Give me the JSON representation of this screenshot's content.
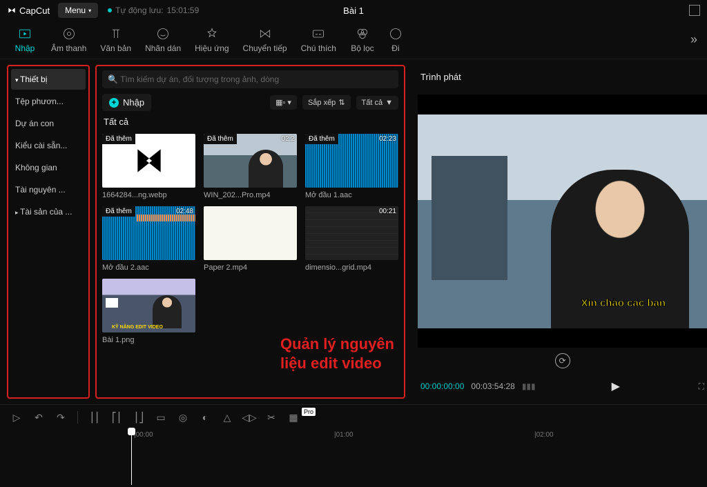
{
  "app": {
    "name": "CapCut",
    "menu_label": "Menu",
    "autosave_prefix": "Tự động lưu:",
    "autosave_time": "15:01:59",
    "project_title": "Bài 1"
  },
  "tabs": [
    {
      "label": "Nhập",
      "icon": "import-icon"
    },
    {
      "label": "Âm thanh",
      "icon": "audio-icon"
    },
    {
      "label": "Văn bản",
      "icon": "text-icon"
    },
    {
      "label": "Nhãn dán",
      "icon": "sticker-icon"
    },
    {
      "label": "Hiệu ứng",
      "icon": "effect-icon"
    },
    {
      "label": "Chuyển tiếp",
      "icon": "transition-icon"
    },
    {
      "label": "Chú thích",
      "icon": "caption-icon"
    },
    {
      "label": "Bộ lọc",
      "icon": "filter-icon"
    },
    {
      "label": "Đi",
      "icon": "adjust-icon"
    }
  ],
  "sidebar": [
    {
      "label": "Thiết bị",
      "kind": "active-expand"
    },
    {
      "label": "Tệp phươn...",
      "kind": ""
    },
    {
      "label": "Dự án con",
      "kind": ""
    },
    {
      "label": "Kiểu cài sẵn...",
      "kind": ""
    },
    {
      "label": "Không gian",
      "kind": ""
    },
    {
      "label": "Tài nguyên ...",
      "kind": ""
    },
    {
      "label": "Tài sản của ...",
      "kind": "collapse"
    }
  ],
  "media": {
    "search_placeholder": "Tìm kiếm dự án, đối tượng trong ảnh, dòng",
    "import_label": "Nhập",
    "view_label": "",
    "sort_label": "Sắp xếp",
    "all_filter_label": "Tất cả",
    "section_title": "Tất cả",
    "items": [
      {
        "name": "1664284...ng.webp",
        "added": "Đã thêm",
        "duration": "",
        "thumb": "capcut-logo"
      },
      {
        "name": "WIN_202...Pro.mp4",
        "added": "Đã thêm",
        "duration": "02:2",
        "thumb": "video-person"
      },
      {
        "name": "Mở đầu 1.aac",
        "added": "Đã thêm",
        "duration": "02:23",
        "thumb": "waveform"
      },
      {
        "name": "Mở đầu 2.aac",
        "added": "Đã thêm",
        "duration": "02:48",
        "thumb": "waveform-orange"
      },
      {
        "name": "Paper 2.mp4",
        "added": "",
        "duration": "",
        "thumb": "white"
      },
      {
        "name": "dimensio...grid.mp4",
        "added": "",
        "duration": "00:21",
        "thumb": "dark"
      },
      {
        "name": "Bài 1.png",
        "added": "",
        "duration": "",
        "thumb": "bai1"
      }
    ],
    "annotation_line1": "Quản lý nguyên",
    "annotation_line2": "liệu edit video"
  },
  "preview": {
    "title": "Trình phát",
    "subtitle": "Xin chào các bạn",
    "time_current": "00:00:00:00",
    "time_total": "00:03:54:28"
  },
  "ruler": {
    "m0": "|00:00",
    "m1": "|01:00",
    "m2": "|02:00"
  },
  "colors": {
    "accent": "#00d6d6",
    "highlight": "#e02020"
  }
}
